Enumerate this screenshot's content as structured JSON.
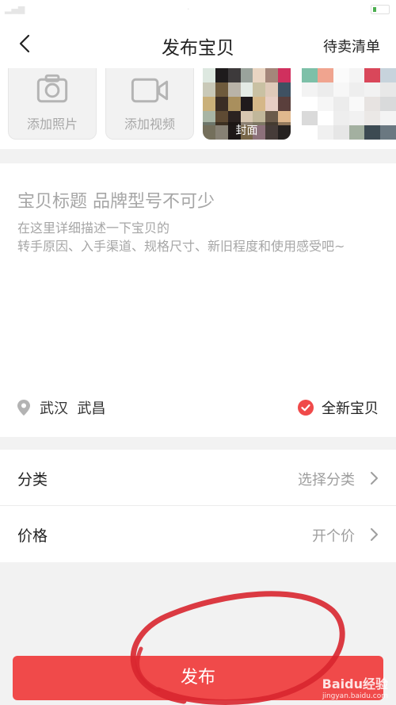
{
  "nav": {
    "title": "发布宝贝",
    "right_link": "待卖清单"
  },
  "media": {
    "add_photo": "添加照片",
    "add_video": "添加视频",
    "cover_label": "封面"
  },
  "listing": {
    "title_placeholder": "宝贝标题 品牌型号不可少",
    "desc_placeholder": "在这里详细描述一下宝贝的\n转手原因、入手渠道、规格尺寸、新旧程度和使用感受吧~",
    "location": "武汉  武昌",
    "condition": "全新宝贝"
  },
  "fields": [
    {
      "label": "分类",
      "value": "选择分类"
    },
    {
      "label": "价格",
      "value": "开个价"
    }
  ],
  "publish_label": "发布",
  "watermark": {
    "main": "Baidu经验",
    "sub": "jingyan.baidu.com"
  },
  "colors": {
    "accent": "#f04a4a",
    "annotation": "#d8262f",
    "placeholder": "#a6a6a6"
  }
}
